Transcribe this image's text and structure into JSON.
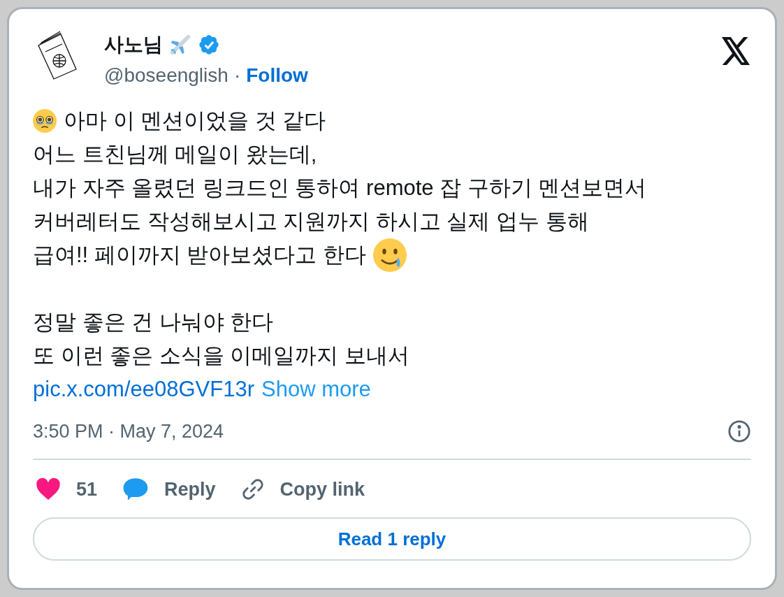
{
  "author": {
    "name": "사노님",
    "handle": "@boseenglish",
    "separator": "·",
    "follow": "Follow"
  },
  "body": {
    "lines": [
      {
        "kind": "line",
        "parts": [
          {
            "kind": "pleading"
          },
          {
            "kind": "text",
            "text": "아마 이 멘션이었을 것 같다"
          }
        ]
      },
      {
        "kind": "line",
        "parts": [
          {
            "kind": "text",
            "text": "어느 트친님께 메일이 왔는데,"
          }
        ]
      },
      {
        "kind": "line",
        "parts": [
          {
            "kind": "text",
            "text": "내가 자주 올렸던 링크드인 통하여 remote 잡 구하기 멘션보면서"
          }
        ]
      },
      {
        "kind": "line",
        "parts": [
          {
            "kind": "text",
            "text": "커버레터도 작성해보시고 지원까지 하시고 실제 업누 통해"
          }
        ]
      },
      {
        "kind": "line",
        "parts": [
          {
            "kind": "text",
            "text": "급여!! 페이까지 받아보셨다고 한다"
          },
          {
            "kind": "tearsmile"
          }
        ]
      },
      {
        "kind": "blank"
      },
      {
        "kind": "line",
        "parts": [
          {
            "kind": "text",
            "text": "정말 좋은 건 나눠야 한다"
          }
        ]
      },
      {
        "kind": "line",
        "parts": [
          {
            "kind": "text",
            "text": "또 이런 좋은 소식을 이메일까지 보내서"
          }
        ]
      }
    ],
    "link": "pic.x.com/ee08GVF13r",
    "show_more": "Show more"
  },
  "timestamp": "3:50 PM · May 7, 2024",
  "actions": [
    {
      "kind": "like",
      "label": "51"
    },
    {
      "kind": "reply",
      "label": "Reply"
    },
    {
      "kind": "copy",
      "label": "Copy link"
    }
  ],
  "read_replies": "Read 1 reply"
}
